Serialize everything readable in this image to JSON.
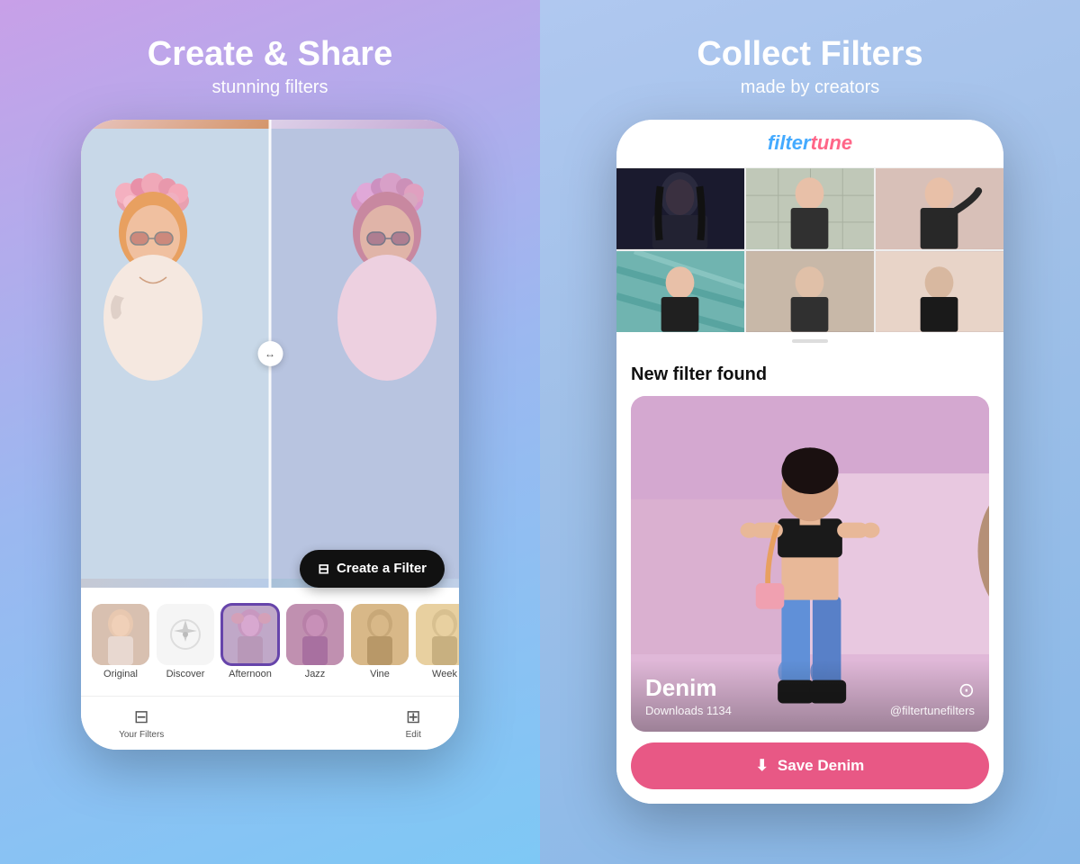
{
  "left": {
    "header": {
      "title": "Create & Share",
      "subtitle": "stunning filters"
    },
    "create_button": "Create a Filter",
    "filters": [
      {
        "id": "original",
        "label": "Original",
        "type": "original"
      },
      {
        "id": "discover",
        "label": "Discover",
        "type": "discover"
      },
      {
        "id": "afternoon",
        "label": "Afternoon",
        "type": "afternoon",
        "active": true
      },
      {
        "id": "jazz",
        "label": "Jazz",
        "type": "jazz"
      },
      {
        "id": "vine",
        "label": "Vine",
        "type": "vine"
      },
      {
        "id": "week",
        "label": "Week",
        "type": "week"
      }
    ],
    "nav": [
      {
        "id": "your-filters",
        "label": "Your Filters",
        "icon": "⊟"
      },
      {
        "id": "edit",
        "label": "Edit",
        "icon": "⊞"
      }
    ]
  },
  "right": {
    "header": {
      "title": "Collect Filters",
      "subtitle": "made by creators"
    },
    "app_name_part1": "filter",
    "app_name_part2": "tune",
    "new_filter_label": "New filter found",
    "filter": {
      "name": "Denim",
      "downloads_label": "Downloads 1134",
      "instagram_handle": "@filtertunefilters"
    },
    "save_button": "Save Denim",
    "save_icon": "⬇"
  }
}
